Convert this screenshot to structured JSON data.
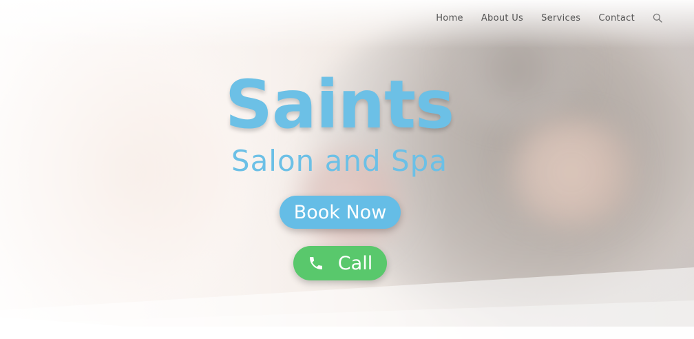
{
  "nav": {
    "items": [
      {
        "label": "Home"
      },
      {
        "label": "About Us"
      },
      {
        "label": "Services"
      },
      {
        "label": "Contact"
      }
    ],
    "search_icon": "search-icon"
  },
  "hero": {
    "title": "Saints",
    "subtitle": "Salon and Spa",
    "book_button": "Book Now",
    "call_button": "Call",
    "call_icon": "phone-icon"
  },
  "colors": {
    "brand_blue": "#6cc0e6",
    "book_button_bg": "#65bde6",
    "call_button_bg": "#59c86c",
    "nav_text": "#555555"
  }
}
